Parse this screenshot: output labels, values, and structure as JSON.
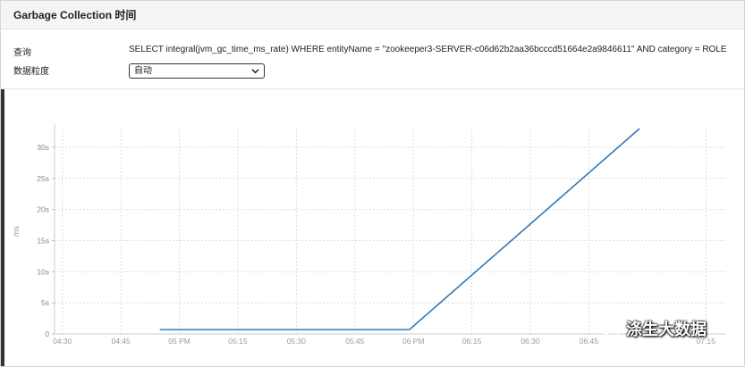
{
  "panel": {
    "title": "Garbage Collection 时间"
  },
  "query": {
    "label": "查询",
    "value": "SELECT integral(jvm_gc_time_ms_rate) WHERE entityName = \"zookeeper3-SERVER-c06d62b2aa36bcccd51664e2a9846611\" AND category = ROLE"
  },
  "granularity": {
    "label": "数据粒度",
    "selected": "自动"
  },
  "chart_data": {
    "type": "line",
    "ylabel": "ms",
    "y_tick_labels": [
      "0",
      "5s",
      "10s",
      "15s",
      "20s",
      "25s",
      "30s"
    ],
    "y_ticks": [
      0,
      5,
      10,
      15,
      20,
      25,
      30
    ],
    "ylim": [
      0,
      33
    ],
    "x_tick_labels": [
      "04:30",
      "04:45",
      "05 PM",
      "05:15",
      "05:30",
      "05:45",
      "06 PM",
      "06:15",
      "06:30",
      "06:45",
      "07:15"
    ],
    "x_ticks_minutes": [
      270,
      285,
      300,
      315,
      330,
      345,
      360,
      375,
      390,
      405,
      435
    ],
    "xlim_minutes": [
      268,
      440
    ],
    "grid": true,
    "series": [
      {
        "color": "#2f7ab8",
        "x": [
          "04:55 PM",
          "05:59 PM",
          "06:58 PM"
        ],
        "x_minutes": [
          295,
          359,
          418
        ],
        "y": [
          0.7,
          0.7,
          33
        ]
      }
    ]
  },
  "watermark": {
    "text": "涤生大数据",
    "icon": "wechat-icon"
  }
}
